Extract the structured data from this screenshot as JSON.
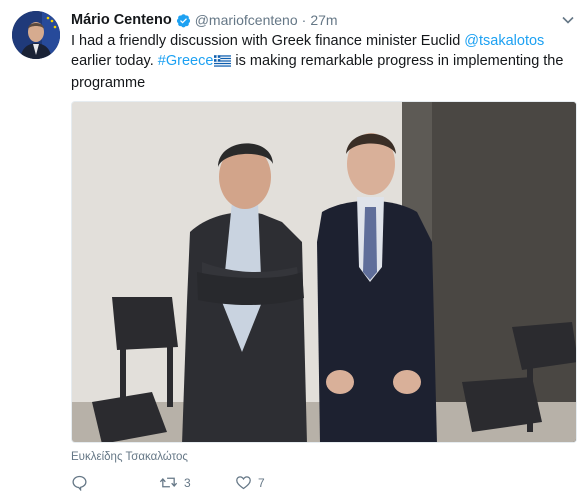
{
  "tweet": {
    "author_name": "Mário Centeno",
    "handle": "@mariofcenteno",
    "separator": "·",
    "time": "27m",
    "verified_icon": "verified-badge-icon",
    "text": {
      "part1": "I had a friendly discussion with Greek finance minister Euclid ",
      "mention": "@tsakalotos",
      "part2": " earlier today. ",
      "hashtag": "#Greece",
      "part3": " is making remarkable progress in implementing the programme"
    },
    "photo_caption": "Ευκλείδης Τσακαλώτος"
  },
  "actions": {
    "reply_icon": "reply-icon",
    "retweet_icon": "retweet-icon",
    "retweet_count": "3",
    "like_icon": "heart-icon",
    "like_count": "7"
  },
  "colors": {
    "link": "#1da1f2",
    "secondary_text": "#657786",
    "primary_text": "#14171a"
  }
}
